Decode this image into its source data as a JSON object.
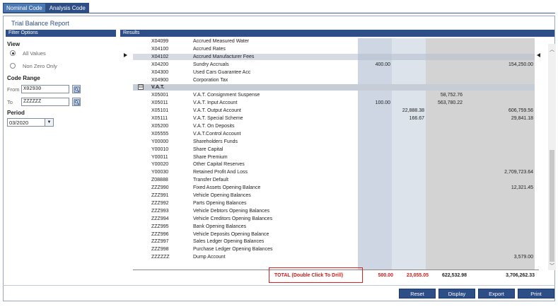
{
  "tabs": [
    {
      "label": "Nominal Code",
      "active": true
    },
    {
      "label": "Analysis Code",
      "active": false
    }
  ],
  "report_title": "Trial Balance Report",
  "filter_panel": {
    "title": "Filter Options",
    "view_label": "View",
    "view_options": [
      {
        "label": "All Values",
        "selected": true
      },
      {
        "label": "Non Zero Only",
        "selected": false
      }
    ],
    "code_range_label": "Code Range",
    "from_label": "From",
    "from_value": "X02930",
    "to_label": "To",
    "to_value": "ZZZZZZ",
    "period_label": "Period",
    "period_value": "03/2020"
  },
  "results_panel": {
    "title": "Results",
    "rows": [
      {
        "code": "X04099",
        "name": "Accrued Measured Water",
        "c1": "",
        "c2": "",
        "c3": "",
        "c4": "",
        "style": "normal"
      },
      {
        "code": "X04100",
        "name": "Accrued Rates",
        "c1": "",
        "c2": "",
        "c3": "",
        "c4": "",
        "style": "normal"
      },
      {
        "code": "X04102",
        "name": "Accrued Manufacturer Fees",
        "c1": "",
        "c2": "",
        "c3": "",
        "c4": "",
        "style": "highlight"
      },
      {
        "code": "X04200",
        "name": "Sundry Accruals",
        "c1": "400.00",
        "c2": "",
        "c3": "",
        "c4": "154,250.00",
        "style": "normal"
      },
      {
        "code": "X04300",
        "name": "Used Cars Guarantee Acc",
        "c1": "",
        "c2": "",
        "c3": "",
        "c4": "",
        "style": "normal"
      },
      {
        "code": "X04900",
        "name": "Corporation Tax",
        "c1": "",
        "c2": "",
        "c3": "",
        "c4": "",
        "style": "normal"
      },
      {
        "code": "V.A.T.",
        "name": "",
        "c1": "",
        "c2": "",
        "c3": "",
        "c4": "",
        "style": "group",
        "toggle": "⊟"
      },
      {
        "code": "X05001",
        "name": "V.A.T. Consignment Suspense",
        "c1": "",
        "c2": "",
        "c3": "58,752.76",
        "c4": "",
        "style": "normal"
      },
      {
        "code": "X05011",
        "name": "V.A.T. Input Account",
        "c1": "100.00",
        "c2": "",
        "c3": "563,780.22",
        "c4": "",
        "style": "normal"
      },
      {
        "code": "X05101",
        "name": "V.A.T. Output Account",
        "c1": "",
        "c2": "22,888.38",
        "c3": "",
        "c4": "606,759.56",
        "style": "normal"
      },
      {
        "code": "X05111",
        "name": "V.A.T. Special Scheme",
        "c1": "",
        "c2": "166.67",
        "c3": "",
        "c4": "29,841.18",
        "style": "normal"
      },
      {
        "code": "X05200",
        "name": "V.A.T. On Deposits",
        "c1": "",
        "c2": "",
        "c3": "",
        "c4": "",
        "style": "normal"
      },
      {
        "code": "X05555",
        "name": "V.A.T.Control Account",
        "c1": "",
        "c2": "",
        "c3": "",
        "c4": "",
        "style": "normal"
      },
      {
        "code": "Y00000",
        "name": "Shareholders Funds",
        "c1": "",
        "c2": "",
        "c3": "",
        "c4": "",
        "style": "normal"
      },
      {
        "code": "Y00010",
        "name": "Share Capital",
        "c1": "",
        "c2": "",
        "c3": "",
        "c4": "",
        "style": "normal"
      },
      {
        "code": "Y00011",
        "name": "Share Premium",
        "c1": "",
        "c2": "",
        "c3": "",
        "c4": "",
        "style": "normal"
      },
      {
        "code": "Y00020",
        "name": "Other Capital Reserves",
        "c1": "",
        "c2": "",
        "c3": "",
        "c4": "",
        "style": "normal"
      },
      {
        "code": "Y00030",
        "name": "Retained Profit And Loss",
        "c1": "",
        "c2": "",
        "c3": "",
        "c4": "2,709,723.64",
        "style": "normal"
      },
      {
        "code": "Z08888",
        "name": "Transfer Default",
        "c1": "",
        "c2": "",
        "c3": "",
        "c4": "",
        "style": "normal"
      },
      {
        "code": "ZZZ990",
        "name": "Fixed Assets Opening Balance",
        "c1": "",
        "c2": "",
        "c3": "",
        "c4": "12,321.45",
        "style": "normal"
      },
      {
        "code": "ZZZ991",
        "name": "Vehicle Opening Balances",
        "c1": "",
        "c2": "",
        "c3": "",
        "c4": "",
        "style": "normal"
      },
      {
        "code": "ZZZ992",
        "name": "Parts Opening Balances",
        "c1": "",
        "c2": "",
        "c3": "",
        "c4": "",
        "style": "normal"
      },
      {
        "code": "ZZZ993",
        "name": "Vehicle Debtors Opening Balances",
        "c1": "",
        "c2": "",
        "c3": "",
        "c4": "",
        "style": "normal"
      },
      {
        "code": "ZZZ994",
        "name": "Vehicle Creditors Opening Balances",
        "c1": "",
        "c2": "",
        "c3": "",
        "c4": "",
        "style": "normal"
      },
      {
        "code": "ZZZ995",
        "name": "Bank Opening Balances",
        "c1": "",
        "c2": "",
        "c3": "",
        "c4": "",
        "style": "normal"
      },
      {
        "code": "ZZZ996",
        "name": "Vehicle Deposits Opening Balance",
        "c1": "",
        "c2": "",
        "c3": "",
        "c4": "",
        "style": "normal"
      },
      {
        "code": "ZZZ997",
        "name": "Sales Ledger Opening Balances",
        "c1": "",
        "c2": "",
        "c3": "",
        "c4": "",
        "style": "normal"
      },
      {
        "code": "ZZZ998",
        "name": "Purchase Ledger Opening Balances",
        "c1": "",
        "c2": "",
        "c3": "",
        "c4": "",
        "style": "normal"
      },
      {
        "code": "ZZZZZZ",
        "name": "Dump Account",
        "c1": "",
        "c2": "",
        "c3": "",
        "c4": "3,579.00",
        "style": "normal"
      }
    ],
    "total": {
      "label": "TOTAL (Double Click To Drill)",
      "c1": "500.00",
      "c2": "23,055.05",
      "c3": "622,532.98",
      "c4": "3,706,262.33"
    }
  },
  "buttons": {
    "reset": "Reset",
    "display": "Display",
    "export": "Export",
    "print": "Print"
  },
  "colors": {
    "tab_active": "#4a78b5",
    "header_bg": "#2d4e86",
    "total_highlight": "#e02020",
    "total_red_text": "#d11a1a"
  },
  "icons": {
    "lookup": "lookup-icon",
    "collapse": "collapse-icon",
    "dropdown": "chevron-down-icon"
  }
}
